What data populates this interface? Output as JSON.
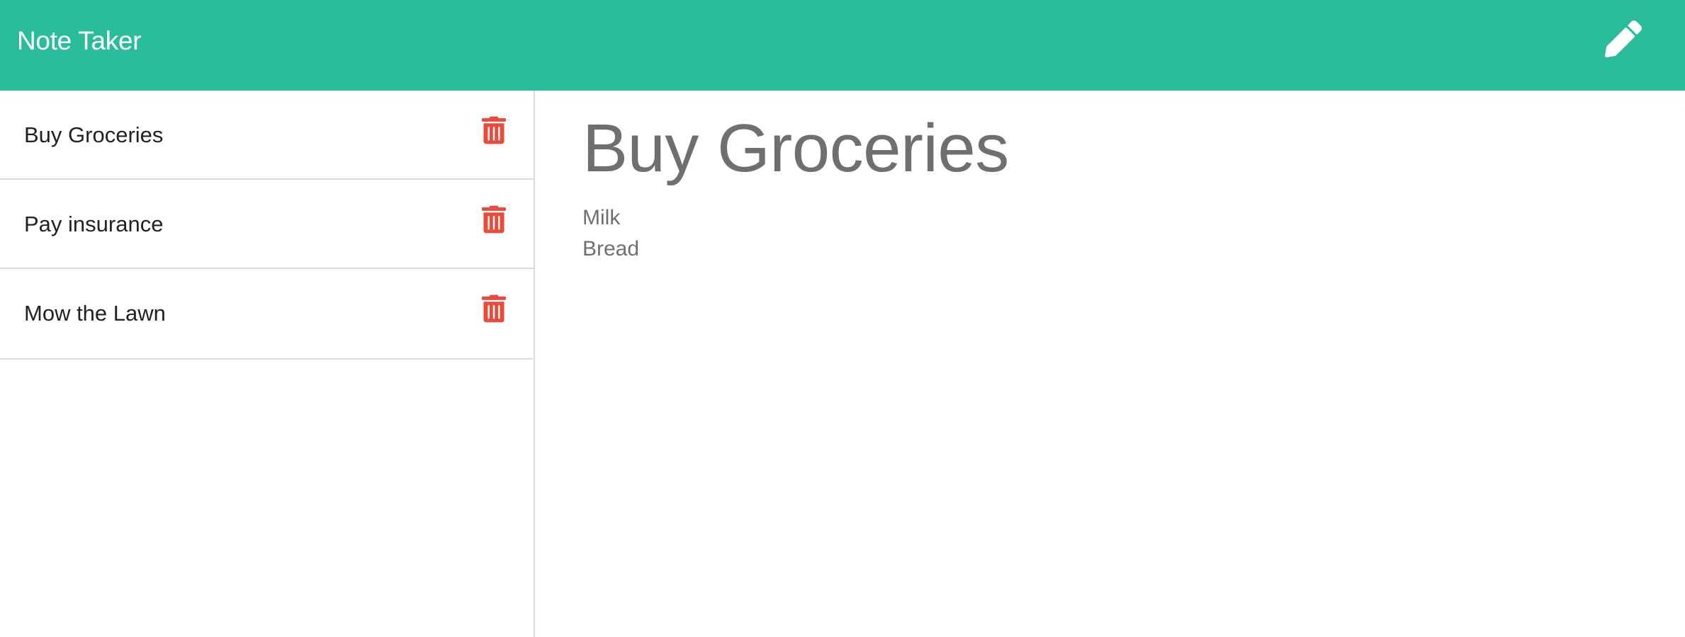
{
  "app": {
    "title": "Note Taker",
    "accent_color": "#2abd9c",
    "new_note_icon": "pencil-icon"
  },
  "sidebar": {
    "notes": [
      {
        "title": "Buy Groceries",
        "delete_icon": "trash-icon"
      },
      {
        "title": "Pay insurance",
        "delete_icon": "trash-icon"
      },
      {
        "title": "Mow the Lawn",
        "delete_icon": "trash-icon"
      }
    ],
    "delete_color": "#e74c3c"
  },
  "main": {
    "note_title": "Buy Groceries",
    "note_lines": [
      "Milk",
      "Bread"
    ]
  }
}
